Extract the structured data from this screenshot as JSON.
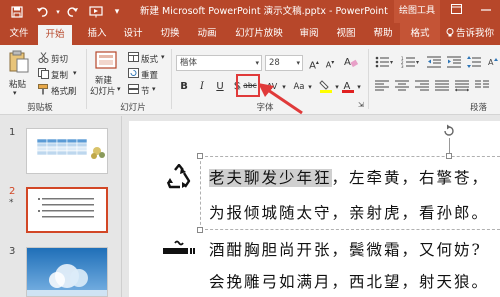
{
  "titlebar": {
    "quick_access": [
      "save-icon",
      "undo-icon",
      "redo-icon",
      "present-icon",
      "customize-icon"
    ],
    "title": "新建 Microsoft PowerPoint 演示文稿.pptx  -  PowerPoint",
    "drawing_tools": "绘图工具",
    "window_buttons": [
      "ribbon-display-icon",
      "minimize-icon",
      "maximize-icon",
      "close-icon"
    ]
  },
  "tabs": [
    "文件",
    "开始",
    "插入",
    "设计",
    "切换",
    "动画",
    "幻灯片放映",
    "审阅",
    "视图",
    "帮助",
    "格式"
  ],
  "active_tab": "开始",
  "tell_me": "告诉我你",
  "ribbon": {
    "clipboard": {
      "paste": "粘贴",
      "cut": "剪切",
      "copy": "复制",
      "format_painter": "格式刷",
      "label": "剪贴板"
    },
    "slides": {
      "new_slide_line1": "新建",
      "new_slide_line2": "幻灯片",
      "layout": "版式",
      "reset": "重置",
      "section": "节",
      "label": "幻灯片"
    },
    "font": {
      "font_name": "楷体",
      "font_size": "28",
      "bold": "B",
      "italic": "I",
      "underline": "U",
      "shadow": "S",
      "strikethrough": "abc",
      "spacing": "AV",
      "case": "Aa",
      "label": "字体"
    },
    "paragraph": {
      "label": "段落"
    }
  },
  "slides_pane": {
    "slides": [
      {
        "number": "1",
        "mark": ""
      },
      {
        "number": "2",
        "mark": "*"
      },
      {
        "number": "3",
        "mark": ""
      }
    ],
    "selected": "2"
  },
  "slide": {
    "lines": [
      {
        "selected": "老夫聊发少年狂",
        "rest": "，左牵黄，右擎苍，"
      },
      {
        "selected": "",
        "rest": "为报倾城随太守，亲射虎，看孙郎。"
      },
      {
        "selected": "",
        "rest": "酒酣胸胆尚开张，鬓微霜，又何妨?"
      },
      {
        "selected": "",
        "rest": "会挽雕弓如满月，西北望，射天狼。"
      }
    ],
    "icons": [
      "recycle-icon",
      "smoking-icon"
    ]
  },
  "colors": {
    "brand": "#b7472a",
    "highlight": "#e03a3a",
    "selection": "#cfcfcf"
  }
}
